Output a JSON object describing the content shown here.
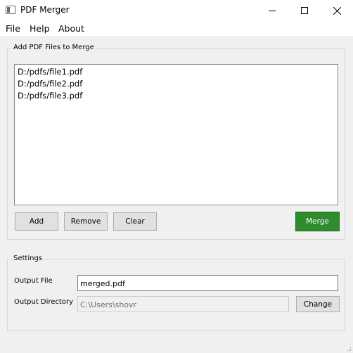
{
  "window": {
    "title": "PDF Merger",
    "controls": {
      "minimize_icon": "minimize-icon",
      "maximize_icon": "maximize-icon",
      "close_icon": "close-icon"
    }
  },
  "menu": {
    "items": [
      {
        "label": "File"
      },
      {
        "label": "Help"
      },
      {
        "label": "About"
      }
    ]
  },
  "files_group": {
    "title": "Add PDF Files to Merge",
    "files": [
      "D:/pdfs/file1.pdf",
      "D:/pdfs/file2.pdf",
      "D:/pdfs/file3.pdf"
    ],
    "buttons": {
      "add": "Add",
      "remove": "Remove",
      "clear": "Clear",
      "merge": "Merge"
    },
    "merge_color": "#2e8b2e"
  },
  "settings_group": {
    "title": "Settings",
    "output_file": {
      "label": "Output File",
      "value": "merged.pdf"
    },
    "output_directory": {
      "label": "Output Directory",
      "value": "C:\\Users\\shovr",
      "enabled": false
    },
    "change_button": "Change"
  }
}
